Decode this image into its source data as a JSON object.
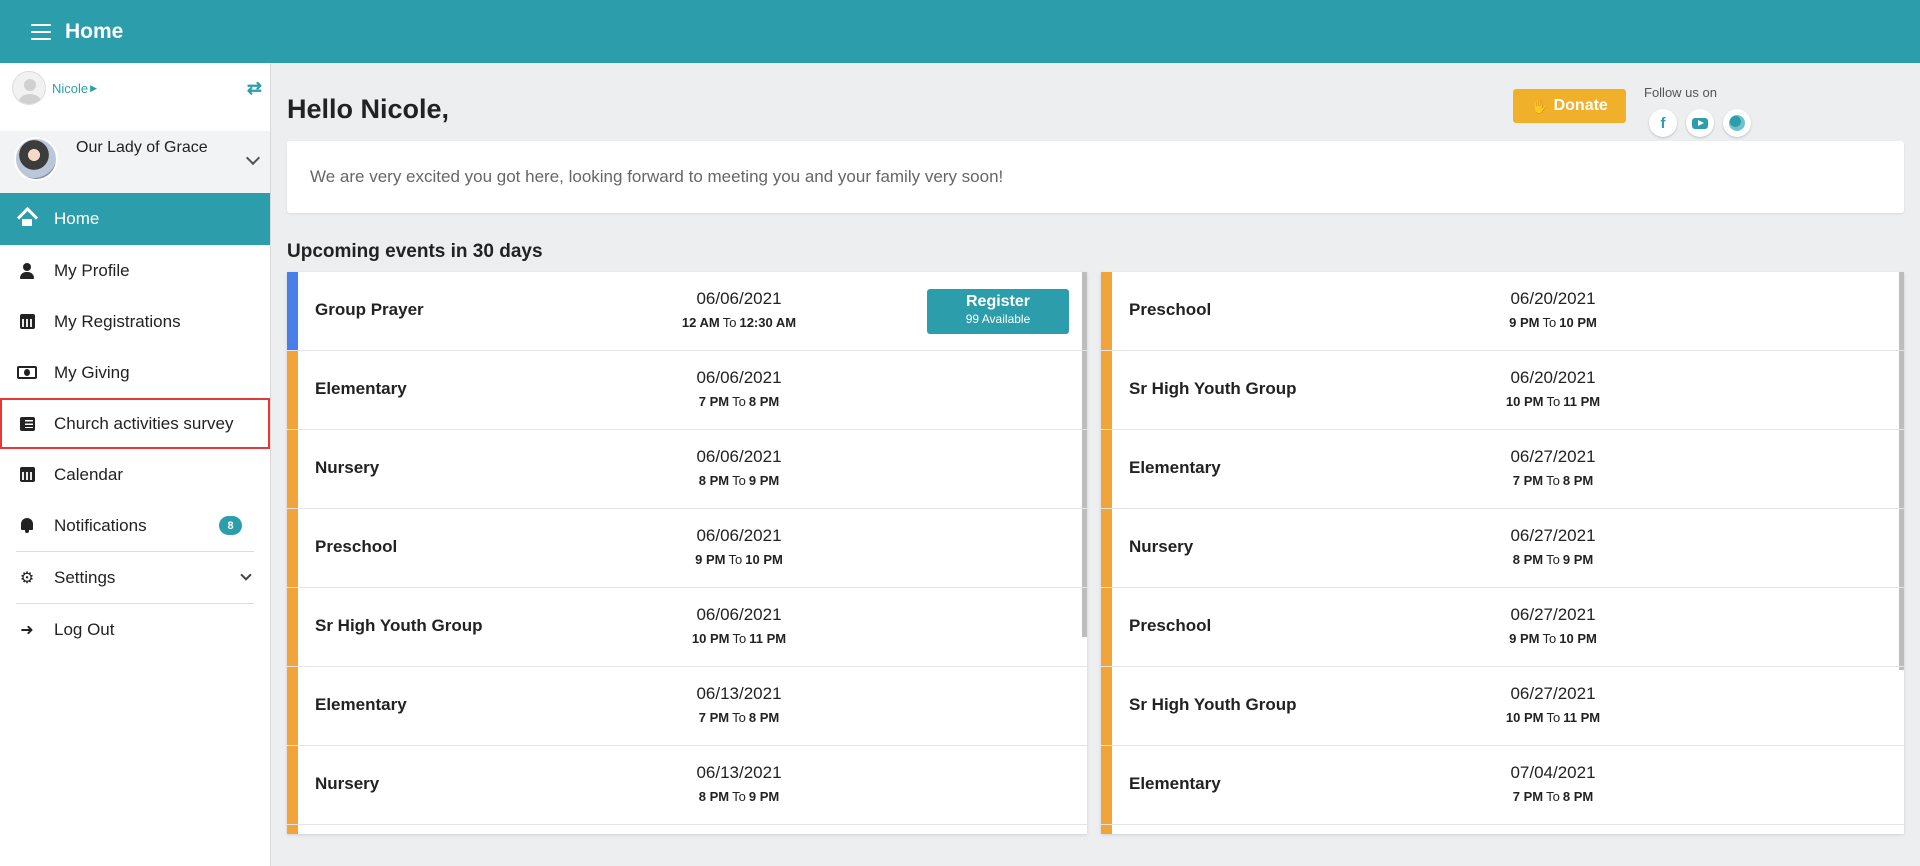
{
  "header": {
    "title": "Home"
  },
  "user": {
    "name": "Nicole"
  },
  "church": {
    "name": "Our Lady of Grace"
  },
  "nav": [
    {
      "label": "Home"
    },
    {
      "label": "My Profile"
    },
    {
      "label": "My Registrations"
    },
    {
      "label": "My Giving"
    },
    {
      "label": "Church activities survey"
    },
    {
      "label": "Calendar"
    },
    {
      "label": "Notifications",
      "badge": "8"
    },
    {
      "label": "Settings"
    },
    {
      "label": "Log Out"
    }
  ],
  "main": {
    "greeting": "Hello Nicole,",
    "donate_label": "Donate",
    "follow_label": "Follow us on",
    "welcome_message": "We are very excited you got here, looking forward to meeting you and your family very soon!",
    "events_heading": "Upcoming events in 30 days",
    "to_label": "To",
    "register": {
      "label": "Register",
      "available": "99 Available"
    }
  },
  "events_left": [
    {
      "name": "Group Prayer",
      "date": "06/06/2021",
      "start": "12 AM",
      "end": "12:30 AM"
    },
    {
      "name": "Elementary",
      "date": "06/06/2021",
      "start": "7 PM",
      "end": "8 PM"
    },
    {
      "name": "Nursery",
      "date": "06/06/2021",
      "start": "8 PM",
      "end": "9 PM"
    },
    {
      "name": "Preschool",
      "date": "06/06/2021",
      "start": "9 PM",
      "end": "10 PM"
    },
    {
      "name": "Sr High Youth Group",
      "date": "06/06/2021",
      "start": "10 PM",
      "end": "11 PM"
    },
    {
      "name": "Elementary",
      "date": "06/13/2021",
      "start": "7 PM",
      "end": "8 PM"
    },
    {
      "name": "Nursery",
      "date": "06/13/2021",
      "start": "8 PM",
      "end": "9 PM"
    }
  ],
  "events_right": [
    {
      "name": "Preschool",
      "date": "06/20/2021",
      "start": "9 PM",
      "end": "10 PM"
    },
    {
      "name": "Sr High Youth Group",
      "date": "06/20/2021",
      "start": "10 PM",
      "end": "11 PM"
    },
    {
      "name": "Elementary",
      "date": "06/27/2021",
      "start": "7 PM",
      "end": "8 PM"
    },
    {
      "name": "Nursery",
      "date": "06/27/2021",
      "start": "8 PM",
      "end": "9 PM"
    },
    {
      "name": "Preschool",
      "date": "06/27/2021",
      "start": "9 PM",
      "end": "10 PM"
    },
    {
      "name": "Sr High Youth Group",
      "date": "06/27/2021",
      "start": "10 PM",
      "end": "11 PM"
    },
    {
      "name": "Elementary",
      "date": "07/04/2021",
      "start": "7 PM",
      "end": "8 PM"
    }
  ],
  "colors": {
    "primary": "#2c9eab",
    "donate": "#f0b02a",
    "event_bar": "#f0a43a",
    "event_bar_featured": "#4a7ee8",
    "highlight_outline": "#e53935"
  }
}
